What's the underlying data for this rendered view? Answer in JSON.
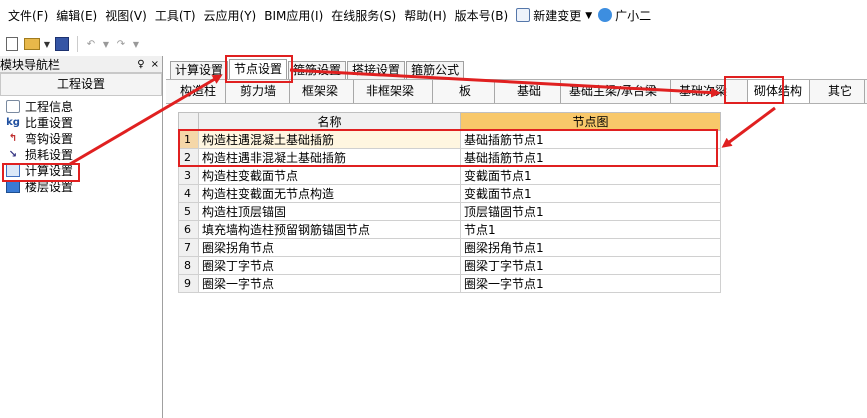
{
  "menu": {
    "items": [
      "文件(F)",
      "编辑(E)",
      "视图(V)",
      "工具(T)",
      "云应用(Y)",
      "BIM应用(I)",
      "在线服务(S)",
      "帮助(H)",
      "版本号(B)"
    ],
    "new_change": "新建变更",
    "user": "广小二"
  },
  "left_panel": {
    "header": "模块导航栏",
    "pin": "♀",
    "close": "×",
    "title": "工程设置",
    "items": [
      "工程信息",
      "比重设置",
      "弯钩设置",
      "损耗设置",
      "计算设置",
      "楼层设置"
    ]
  },
  "tabs": [
    "计算设置",
    "节点设置",
    "箍筋设置",
    "搭接设置",
    "箍筋公式"
  ],
  "subtabs": [
    "构造柱",
    "剪力墙",
    "框架梁",
    "非框架梁",
    "板",
    "基础",
    "基础主梁/承台梁",
    "基础次梁",
    "砌体结构",
    "其它"
  ],
  "grid": {
    "headers": {
      "name": "名称",
      "node": "节点图"
    },
    "rows": [
      {
        "num": "1",
        "name": "构造柱遇混凝土基础插筋",
        "node": "基础插筋节点1"
      },
      {
        "num": "2",
        "name": "构造柱遇非混凝土基础插筋",
        "node": "基础插筋节点1"
      },
      {
        "num": "3",
        "name": "构造柱变截面节点",
        "node": "变截面节点1"
      },
      {
        "num": "4",
        "name": "构造柱变截面无节点构造",
        "node": "变截面节点1"
      },
      {
        "num": "5",
        "name": "构造柱顶层锚固",
        "node": "顶层锚固节点1"
      },
      {
        "num": "6",
        "name": "填充墙构造柱预留钢筋锚固节点",
        "node": "节点1"
      },
      {
        "num": "7",
        "name": "圈梁拐角节点",
        "node": "圈梁拐角节点1"
      },
      {
        "num": "8",
        "name": "圈梁丁字节点",
        "node": "圈梁丁字节点1"
      },
      {
        "num": "9",
        "name": "圈梁一字节点",
        "node": "圈梁一字节点1"
      }
    ]
  },
  "colors": {
    "annotation": "#e02020",
    "node_header": "#f8c86a"
  }
}
